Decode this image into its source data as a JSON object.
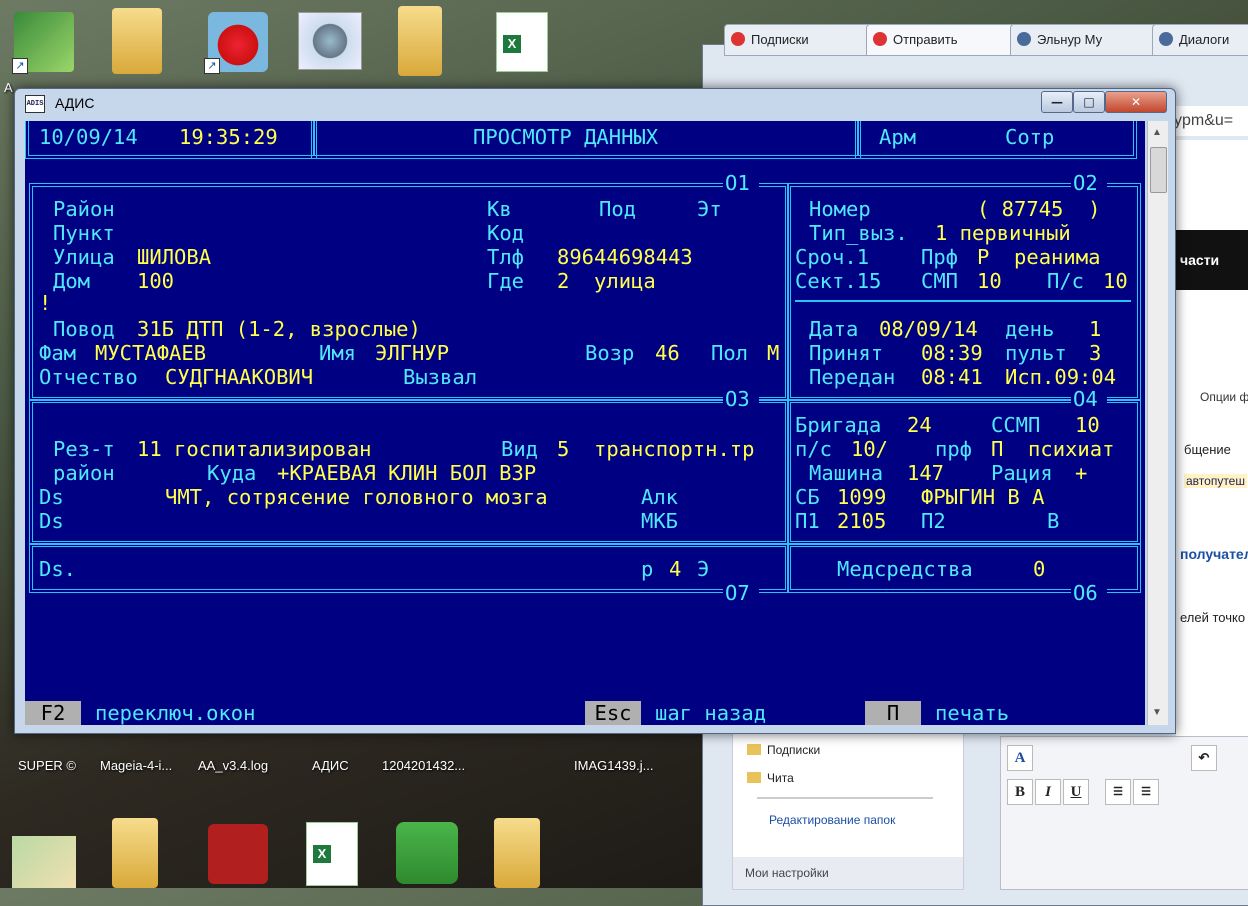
{
  "desktop": {
    "top_icons": [
      {
        "label": "A",
        "name": "money-app"
      },
      {
        "label": "",
        "name": "folder"
      },
      {
        "label": "",
        "name": "angry-birds"
      },
      {
        "label": "",
        "name": "settings"
      },
      {
        "label": "",
        "name": "folder"
      },
      {
        "label": "",
        "name": "excel"
      }
    ],
    "bottom_labels": [
      "SUPER ©",
      "Mageia-4-i...",
      "AA_v3.4.log",
      "АДИС",
      "1204201432...",
      "IMAG1439.j..."
    ]
  },
  "browser": {
    "tabs": [
      "Подписки",
      "Отправить",
      "Эльнур Му",
      "Диалоги"
    ],
    "address": "ypm&u=",
    "right_text": [
      "части",
      "Опции ф",
      "бщение",
      "автопутеш",
      "получател",
      "елей точко"
    ],
    "sidebar_items": [
      "Подписки",
      "Чита"
    ],
    "sidebar_link": "Редактирование папок",
    "sidebar_header": "Мои настройки",
    "editor_buttons": [
      "B",
      "I",
      "U"
    ]
  },
  "window": {
    "title": "АДИС",
    "buttons": {
      "minimize": "—",
      "maximize": "□",
      "close": "✕"
    }
  },
  "console": {
    "header": {
      "date": "10/09/14",
      "time": "19:35:29",
      "title": "ПРОСМОТР ДАННЫХ",
      "arm": "Арм",
      "sotr": "Сотр"
    },
    "o1": {
      "tag": "О1",
      "rayon_label": "Район",
      "punkt_label": "Пункт",
      "ulitsa_label": "Улица",
      "ulitsa": "ШИЛОВА",
      "dom_label": "Дом",
      "dom": "100",
      "kv_label": "Кв",
      "pod_label": "Под",
      "et_label": "Эт",
      "kod_label": "Код",
      "tlf_label": "Тлф",
      "tlf": "89644698443",
      "gde_label": "Где",
      "gde": "2  улица",
      "bang": "!",
      "povod_label": "Повод",
      "povod": "31Б ДТП (1-2, взрослые)",
      "fam_label": "Фам",
      "fam": "МУСТАФАЕВ",
      "imya_label": "Имя",
      "imya": "ЭЛГНУР",
      "vozr_label": "Возр",
      "vozr": "46",
      "pol_label": "Пол",
      "pol": "М",
      "otch_label": "Отчество",
      "otch": "СУДГНААКОВИЧ",
      "vyzval_label": "Вызвал"
    },
    "o2": {
      "tag": "О2",
      "nomer_label": "Номер",
      "nomer": "( 87745  )",
      "tip_label": "Тип_выз.",
      "tip": "1 первичный",
      "sroch": "Сроч.1",
      "prf_label": "Прф",
      "prf": "Р  реанима",
      "sekt": "Сект.15",
      "smp_label": "СМП",
      "smp": "10",
      "ps_label": "П/с",
      "ps": "10",
      "data_label": "Дата",
      "data": "08/09/14",
      "den_label": "день",
      "den": "1",
      "prinyat_label": "Принят",
      "prinyat": "08:39",
      "pult_label": "пульт",
      "pult": "3",
      "peredan_label": "Передан",
      "peredan": "08:41",
      "isp": "Исп.09:04"
    },
    "o3": {
      "tag": "О3",
      "rez_label": "Рез-т",
      "rez": "11 госпитализирован",
      "vid_label": "Вид",
      "vid": "5  транспортн.тр",
      "rayon_label": "район",
      "kuda_label": "Куда",
      "kuda": "+КРАЕВАЯ КЛИН БОЛ ВЗР",
      "ds1_label": "Ds",
      "ds1": "ЧМТ, сотрясение головного мозга",
      "alk_label": "Алк",
      "ds2_label": "Ds",
      "mkb_label": "МКБ"
    },
    "o4": {
      "tag": "О4",
      "brig_label": "Бригада",
      "brig": "24",
      "ssmp_label": "ССМП",
      "ssmp": "10",
      "ps_label": "п/с",
      "ps": "10/",
      "prf_label": "прф",
      "prf": "П  психиат",
      "mash_label": "Машина",
      "mash": "147",
      "rac_label": "Рация",
      "rac": "+",
      "sb_label": "СБ",
      "sb": "1099",
      "sb_name": "ФРЫГИН В А",
      "p1_label": "П1",
      "p1": "2105",
      "p2_label": "П2",
      "v_label": "В"
    },
    "o7": {
      "tag": "О7",
      "ds_label": "Ds.",
      "r_label": "р",
      "r": "4",
      "e_label": "Э"
    },
    "o6": {
      "tag": "О6",
      "med_label": "Медсредства",
      "med": "0"
    },
    "footer": {
      "f2_key": "F2",
      "f2_label": "переключ.окон",
      "esc_key": "Esc",
      "esc_label": "шаг назад",
      "p_key": "П",
      "p_label": "печать"
    }
  }
}
